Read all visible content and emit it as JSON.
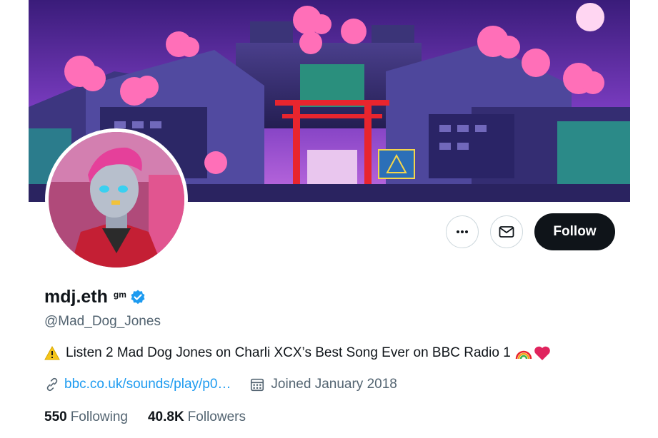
{
  "profile": {
    "display_name": "mdj.eth",
    "name_badge": "gm",
    "handle": "@Mad_Dog_Jones",
    "bio": "Listen 2 Mad Dog Jones on Charli XCX’s Best Song Ever on BBC Radio 1",
    "link": "bbc.co.uk/sounds/play/p0…",
    "joined": "Joined January 2018",
    "following_count": "550",
    "following_label": "Following",
    "followers_count": "40.8K",
    "followers_label": "Followers"
  },
  "actions": {
    "follow_label": "Follow",
    "more_icon": "more-icon",
    "message_icon": "envelope-icon"
  },
  "colors": {
    "accent": "#1d9bf0",
    "follow_button": "#0f1419",
    "secondary_text": "#536471",
    "verified": "#1d9bf0"
  }
}
